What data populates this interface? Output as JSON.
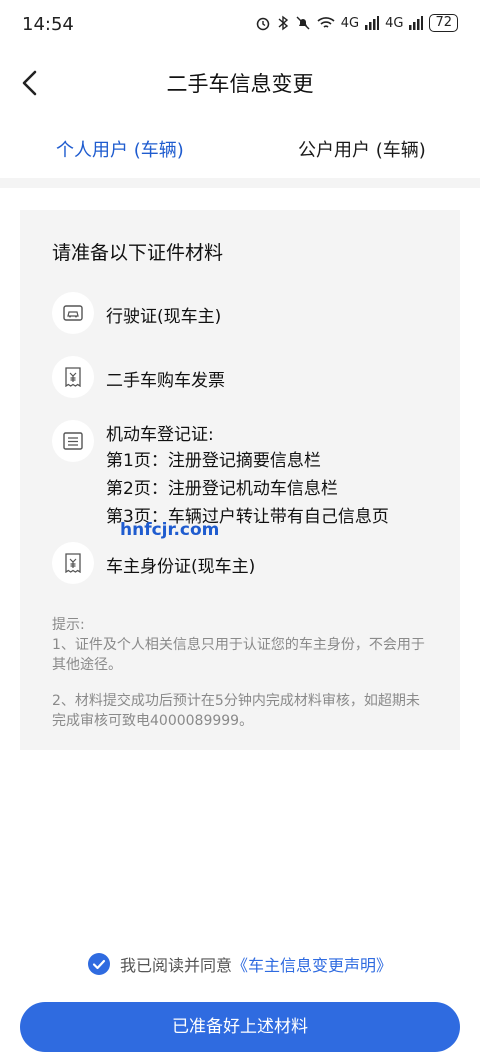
{
  "status_bar": {
    "time": "14:54",
    "net1": "4G",
    "net2": "4G",
    "battery": "72"
  },
  "header": {
    "title": "二手车信息变更"
  },
  "tabs": [
    {
      "label": "个人用户 (车辆)"
    },
    {
      "label": "公户用户 (车辆)"
    }
  ],
  "card": {
    "title": "请准备以下证件材料",
    "items": [
      {
        "label": "行驶证(现车主)",
        "icon": "car-license-icon"
      },
      {
        "label": "二手车购车发票",
        "icon": "invoice-icon"
      },
      {
        "label": "机动车登记证:",
        "icon": "document-icon"
      },
      {
        "label": "车主身份证(现车主)",
        "icon": "invoice-icon"
      }
    ],
    "registration_pages": [
      "第1页：注册登记摘要信息栏",
      "第2页：注册登记机动车信息栏",
      "第3页：车辆过户转让带有自己信息页"
    ],
    "watermark": "hnfcjr.com",
    "tips": {
      "heading": "提示:",
      "line1": "1、证件及个人相关信息只用于认证您的车主身份，不会用于其他途径。",
      "line2": "2、材料提交成功后预计在5分钟内完成材料审核，如超期未完成审核可致电4000089999。"
    }
  },
  "agreement": {
    "prefix": "我已阅读并同意",
    "link": "《车主信息变更声明》"
  },
  "button": {
    "label": "已准备好上述材料"
  },
  "colors": {
    "accent": "#2f6be0",
    "tab_active": "#1f5ccf",
    "card_bg": "#f4f4f4"
  }
}
